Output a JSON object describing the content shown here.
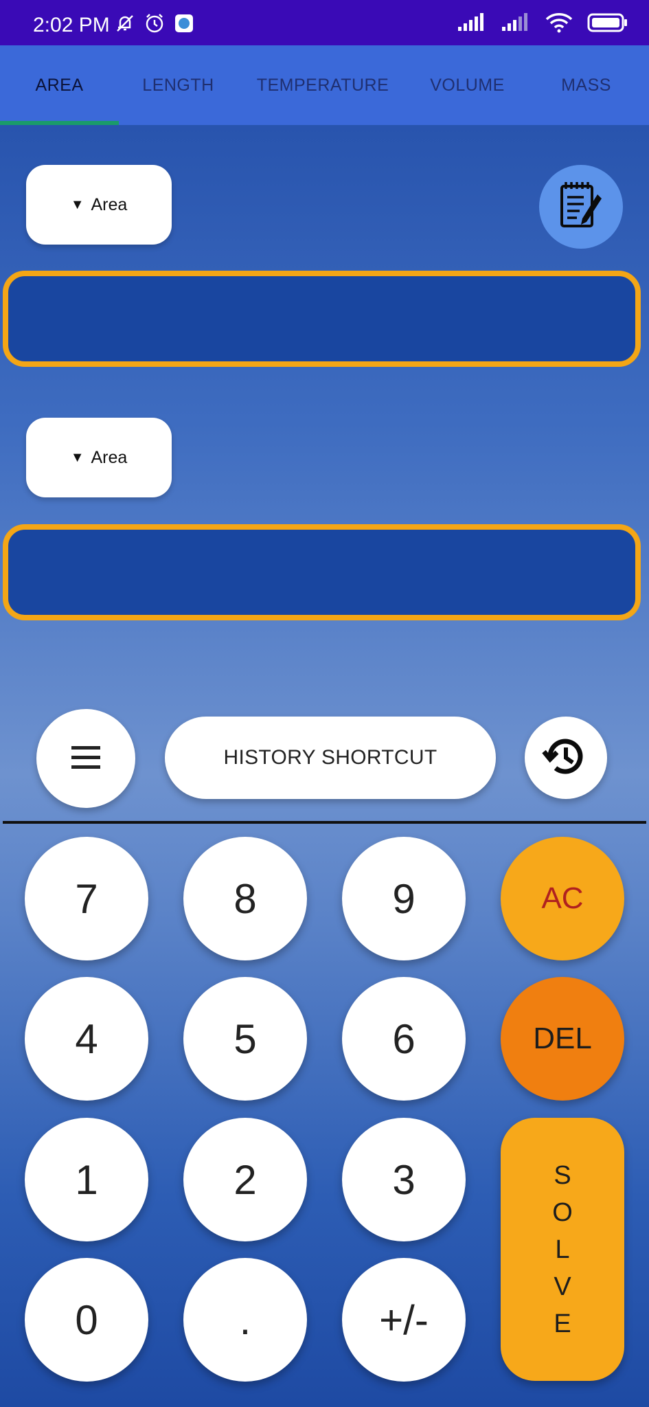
{
  "status_bar": {
    "time": "2:02 PM"
  },
  "tabs": [
    {
      "label": "AREA",
      "active": true
    },
    {
      "label": "LENGTH"
    },
    {
      "label": "TEMPERATURE"
    },
    {
      "label": "VOLUME"
    },
    {
      "label": "MASS"
    }
  ],
  "from_unit": {
    "label": "Area"
  },
  "to_unit": {
    "label": "Area"
  },
  "from_value": "",
  "to_value": "",
  "history_shortcut_label": "HISTORY SHORTCUT",
  "keypad": {
    "k7": "7",
    "k8": "8",
    "k9": "9",
    "ac": "AC",
    "k4": "4",
    "k5": "5",
    "k6": "6",
    "del": "DEL",
    "k1": "1",
    "k2": "2",
    "k3": "3",
    "k0": "0",
    "dot": ".",
    "sign": "+/-",
    "solve_letters": [
      "S",
      "O",
      "L",
      "V",
      "E"
    ]
  },
  "colors": {
    "status_bar": "#3a0ab6",
    "tab_bar": "#3b69d9",
    "tab_indicator": "#1a9b6a",
    "field_fill": "#1946a0",
    "field_border": "#f4a616",
    "ac_key": "#f7a81a",
    "del_key": "#f07f10",
    "solve_key": "#f7a81a"
  }
}
